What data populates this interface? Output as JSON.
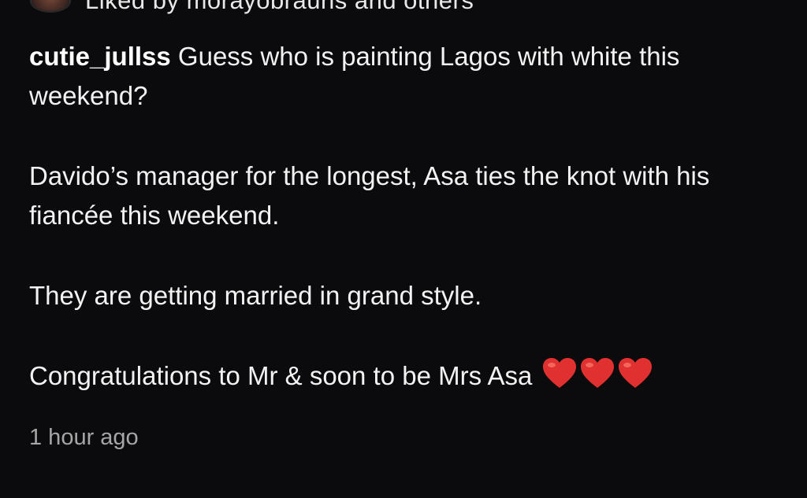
{
  "liked_by": {
    "text": "Liked by morayobrauns and others"
  },
  "post": {
    "username": "cutie_jullss",
    "caption_line1": "Guess who is painting Lagos with white this weekend?",
    "caption_line2": "Davido’s manager for the longest, Asa ties the knot with his fiancée this weekend.",
    "caption_line3": "They are getting married in grand style.",
    "caption_line4": "Congratulations to Mr & soon to be Mrs Asa",
    "emoji": [
      "red-heart-icon",
      "red-heart-icon",
      "red-heart-icon"
    ],
    "timestamp": "1 hour ago"
  },
  "colors": {
    "background": "#0b0b0d",
    "text": "#f2f2f2",
    "muted": "#a6a6a6",
    "heart": "#e0302f"
  }
}
